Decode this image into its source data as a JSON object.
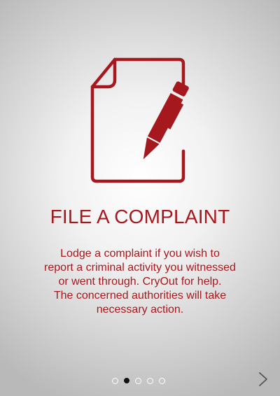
{
  "onboarding": {
    "icon": "file-complaint-document-pen-icon",
    "title": "FILE A COMPLAINT",
    "description_lines": [
      "Lodge a complaint if you wish to",
      "report a criminal activity you witnessed",
      "or went through. CryOut for help.",
      "The concerned authorities will take",
      "necessary action."
    ]
  },
  "pagination": {
    "total_pages": 5,
    "current_page": 2
  },
  "navigation": {
    "next_icon": "chevron-right-icon"
  },
  "colors": {
    "accent": "#a5191e",
    "dot_active": "#111111",
    "dot_inactive": "#ffffff"
  }
}
